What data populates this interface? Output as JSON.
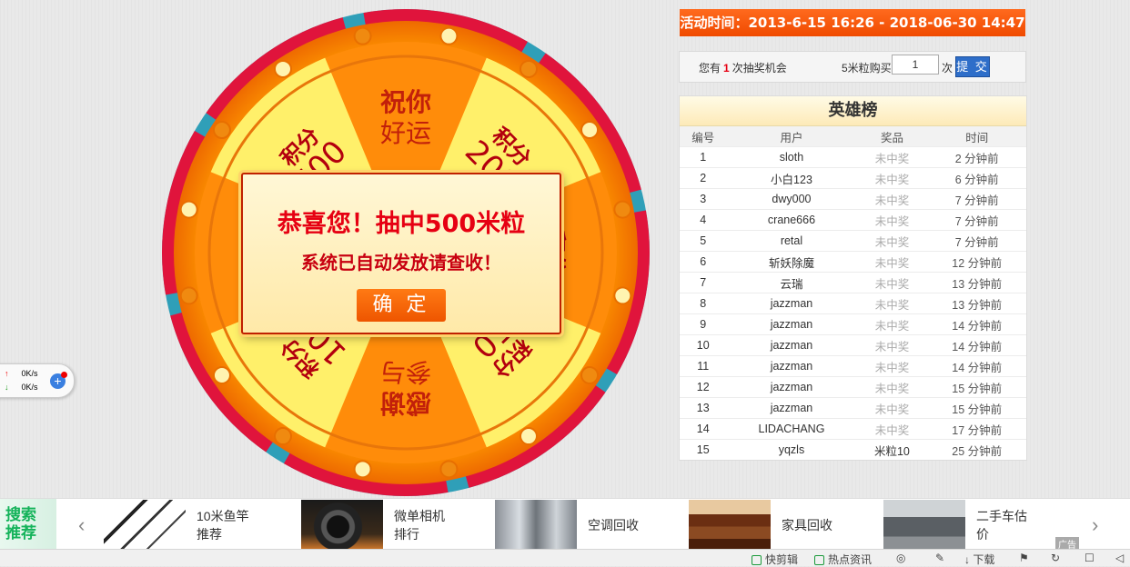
{
  "wheel": {
    "segments": [
      {
        "line1": "祝你",
        "line2": "好运"
      },
      {
        "line1": "积分",
        "line2": "200"
      },
      {
        "line1": "积分",
        "line2": "50"
      },
      {
        "line1": "积分",
        "line2": "50"
      },
      {
        "line1": "感谢",
        "line2": "参与"
      },
      {
        "line1": "积分",
        "line2": "100"
      },
      {
        "line1": "积分",
        "line2": "积分"
      },
      {
        "line1": "积分",
        "line2": "500"
      }
    ]
  },
  "popup": {
    "line1": "恭喜您！抽中500米粒",
    "line2": "系统已自动发放请查收！",
    "confirm": "确 定"
  },
  "activity": {
    "label": "活动时间：",
    "range": "2013-6-15 16:26 - 2018-06-30 14:47"
  },
  "chance": {
    "prefix": "您有",
    "count": "1",
    "suffix": "次抽奖机会",
    "buy_label": "5米粒购买",
    "qty": "1",
    "unit": "次",
    "submit": "提 交"
  },
  "board": {
    "title": "英雄榜",
    "columns": [
      "编号",
      "用户",
      "奖品",
      "时间"
    ],
    "rows": [
      [
        "1",
        "sloth",
        "未中奖",
        "2 分钟前"
      ],
      [
        "2",
        "小白123",
        "未中奖",
        "6 分钟前"
      ],
      [
        "3",
        "dwy000",
        "未中奖",
        "7 分钟前"
      ],
      [
        "4",
        "crane666",
        "未中奖",
        "7 分钟前"
      ],
      [
        "5",
        "retal",
        "未中奖",
        "7 分钟前"
      ],
      [
        "6",
        "斩妖除魔",
        "未中奖",
        "12 分钟前"
      ],
      [
        "7",
        "云瑞",
        "未中奖",
        "13 分钟前"
      ],
      [
        "8",
        "jazzman",
        "未中奖",
        "13 分钟前"
      ],
      [
        "9",
        "jazzman",
        "未中奖",
        "14 分钟前"
      ],
      [
        "10",
        "jazzman",
        "未中奖",
        "14 分钟前"
      ],
      [
        "11",
        "jazzman",
        "未中奖",
        "14 分钟前"
      ],
      [
        "12",
        "jazzman",
        "未中奖",
        "15 分钟前"
      ],
      [
        "13",
        "jazzman",
        "未中奖",
        "15 分钟前"
      ],
      [
        "14",
        "LIDACHANG",
        "未中奖",
        "17 分钟前"
      ],
      [
        "15",
        "yqzls",
        "米粒10",
        "25 分钟前"
      ]
    ]
  },
  "net": {
    "up": "0K/s",
    "down": "0K/s"
  },
  "ads": {
    "tag": "搜索推荐",
    "items": [
      {
        "line1": "10米鱼竿",
        "line2": "推荐"
      },
      {
        "line1": "微单相机",
        "line2": "排行"
      },
      {
        "line1": "空调回收",
        "line2": ""
      },
      {
        "line1": "家具回收",
        "line2": ""
      },
      {
        "line1": "二手车估",
        "line2": "价"
      }
    ],
    "mark": "广告"
  },
  "status": {
    "items": [
      "快剪辑",
      "热点资讯",
      "下载"
    ]
  },
  "colors": {
    "accent": "#ff5a00",
    "wheel_rim": "#ff8a00",
    "wheel_outer_red": "#e0143c",
    "wheel_outer_teal": "#2f9fb8",
    "popup_text": "#e60012"
  }
}
